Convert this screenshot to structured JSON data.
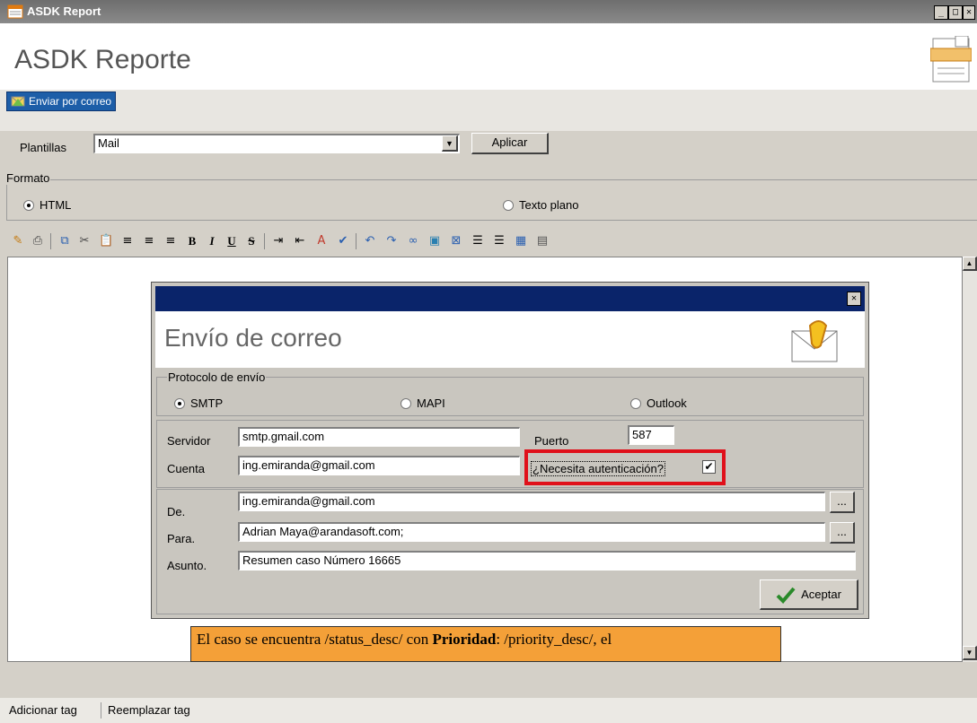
{
  "window": {
    "title": "ASDK Report"
  },
  "app": {
    "title": "ASDK Reporte"
  },
  "send_button": {
    "label": "Enviar por correo"
  },
  "templates": {
    "label": "Plantillas",
    "selected": "Mail",
    "apply_label": "Aplicar"
  },
  "format": {
    "legend": "Formato",
    "html_label": "HTML",
    "plain_label": "Texto plano",
    "selected": "HTML"
  },
  "dialog": {
    "heading": "Envío de correo",
    "protocol": {
      "legend": "Protocolo de envío",
      "smtp": "SMTP",
      "mapi": "MAPI",
      "outlook": "Outlook",
      "selected": "SMTP"
    },
    "server": {
      "label": "Servidor",
      "value": "smtp.gmail.com"
    },
    "port": {
      "label": "Puerto",
      "value": "587"
    },
    "account": {
      "label": "Cuenta",
      "value": "ing.emiranda@gmail.com"
    },
    "auth": {
      "label": "¿Necesita autenticación?",
      "checked": true
    },
    "from": {
      "label": "De.",
      "value": "ing.emiranda@gmail.com"
    },
    "to": {
      "label": "Para.",
      "value": "Adrian Maya@arandasoft.com;"
    },
    "subject": {
      "label": "Asunto.",
      "value": "Resumen caso Número 16665"
    },
    "browse_label": "...",
    "accept_label": "Aceptar"
  },
  "banner": {
    "text_before": "El caso se encuentra /status_desc/ con ",
    "bold": "Prioridad",
    "text_after": ": /priority_desc/, el"
  },
  "footer": {
    "add_tag": "Adicionar tag",
    "replace_tag": "Reemplazar tag"
  },
  "colors": {
    "titlebar": "#0a246a",
    "highlight": "#e0101a",
    "banner": "#f4a038",
    "send_button": "#1d5ea8"
  }
}
